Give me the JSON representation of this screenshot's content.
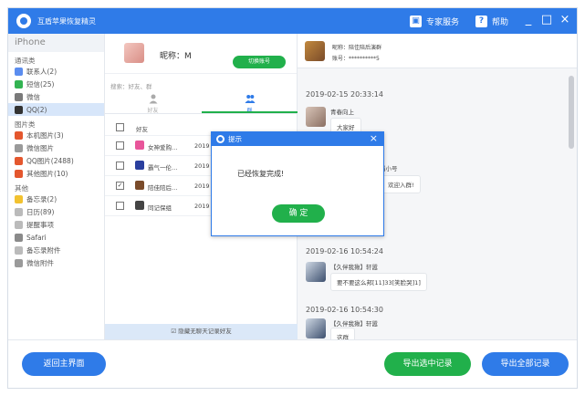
{
  "app": {
    "title": "互盾苹果恢复精灵"
  },
  "titlebar": {
    "expert_label": "专家服务",
    "help_label": "帮助",
    "minimize": "_",
    "maximize": "□",
    "close": "×"
  },
  "sidebar": {
    "device": "iPhone",
    "categories": [
      {
        "label": "通讯类",
        "items": [
          {
            "label": "联系人(2)",
            "icon": "contacts-icon",
            "color": "#5b8def"
          },
          {
            "label": "短信(25)",
            "icon": "sms-icon",
            "color": "#33b352"
          },
          {
            "label": "微信",
            "icon": "wechat-icon",
            "color": "#7a7a7a"
          },
          {
            "label": "QQ(2)",
            "icon": "qq-icon",
            "color": "#333333",
            "active": true
          }
        ]
      },
      {
        "label": "图片类",
        "items": [
          {
            "label": "本机图片(3)",
            "icon": "photo-icon",
            "color": "#e4572e"
          },
          {
            "label": "微信图片",
            "icon": "wechat-photo-icon",
            "color": "#9a9a9a"
          },
          {
            "label": "QQ图片(2488)",
            "icon": "qq-photo-icon",
            "color": "#e4572e"
          },
          {
            "label": "其他图片(10)",
            "icon": "other-photo-icon",
            "color": "#e4572e"
          }
        ]
      },
      {
        "label": "其他",
        "items": [
          {
            "label": "备忘录(2)",
            "icon": "memo-icon",
            "color": "#f2c230"
          },
          {
            "label": "日历(89)",
            "icon": "calendar-icon",
            "color": "#bbbbbb"
          },
          {
            "label": "提醒事项",
            "icon": "reminder-icon",
            "color": "#bbbbbb"
          },
          {
            "label": "Safari",
            "icon": "safari-icon",
            "color": "#8a8a8a"
          },
          {
            "label": "备忘录附件",
            "icon": "memo-attachment-icon",
            "color": "#bbbbbb"
          },
          {
            "label": "微信附件",
            "icon": "wechat-attachment-icon",
            "color": "#9a9a9a"
          }
        ]
      }
    ]
  },
  "middle": {
    "nickname": "昵称：M",
    "switch_label": "切换账号",
    "search_label": "搜索：好友、群",
    "tabs": [
      {
        "label": "好友"
      },
      {
        "label": "群"
      }
    ],
    "column_header": "好友",
    "rows": [
      {
        "name": "女神爱购…",
        "date": "2019",
        "checked": false,
        "color": "#e8559a"
      },
      {
        "name": "霸气一伦…",
        "date": "2019",
        "checked": false,
        "color": "#2a3f9e"
      },
      {
        "name": "陪佳陪后…",
        "date": "2019",
        "checked": true,
        "color": "#7a4b2a"
      },
      {
        "name": "同记保组",
        "date": "2019",
        "checked": false,
        "color": "#444444"
      }
    ],
    "hide_label": "☑ 隐藏无聊天记录好友"
  },
  "chat": {
    "header_name": "昵称：陪佳陪后演群",
    "header_account": "账号：**********5",
    "messages": [
      {
        "time": "2019-02-15 20:33:14",
        "sender": "青春向上",
        "text": "大家好"
      },
      {
        "sender": "霸小号",
        "text": "欢迎入群!"
      },
      {
        "sender": "群主",
        "text": ""
      },
      {
        "time": "2019-02-16 10:54:24",
        "sender": "【久伴我揪】轩嚣",
        "text": "要不要这么邦[11]33[笑脸哭]1]"
      },
      {
        "time": "2019-02-16 10:54:30",
        "sender": "【久伴我揪】轩嚣",
        "text": "这群"
      }
    ]
  },
  "bottom": {
    "back_label": "返回主界面",
    "export_selected_label": "导出选中记录",
    "export_all_label": "导出全部记录"
  },
  "modal": {
    "title": "提示",
    "message": "已经恢复完成!",
    "ok_label": "确 定",
    "close": "×"
  },
  "colors": {
    "primary": "#2f7be8",
    "green": "#21b04b"
  }
}
